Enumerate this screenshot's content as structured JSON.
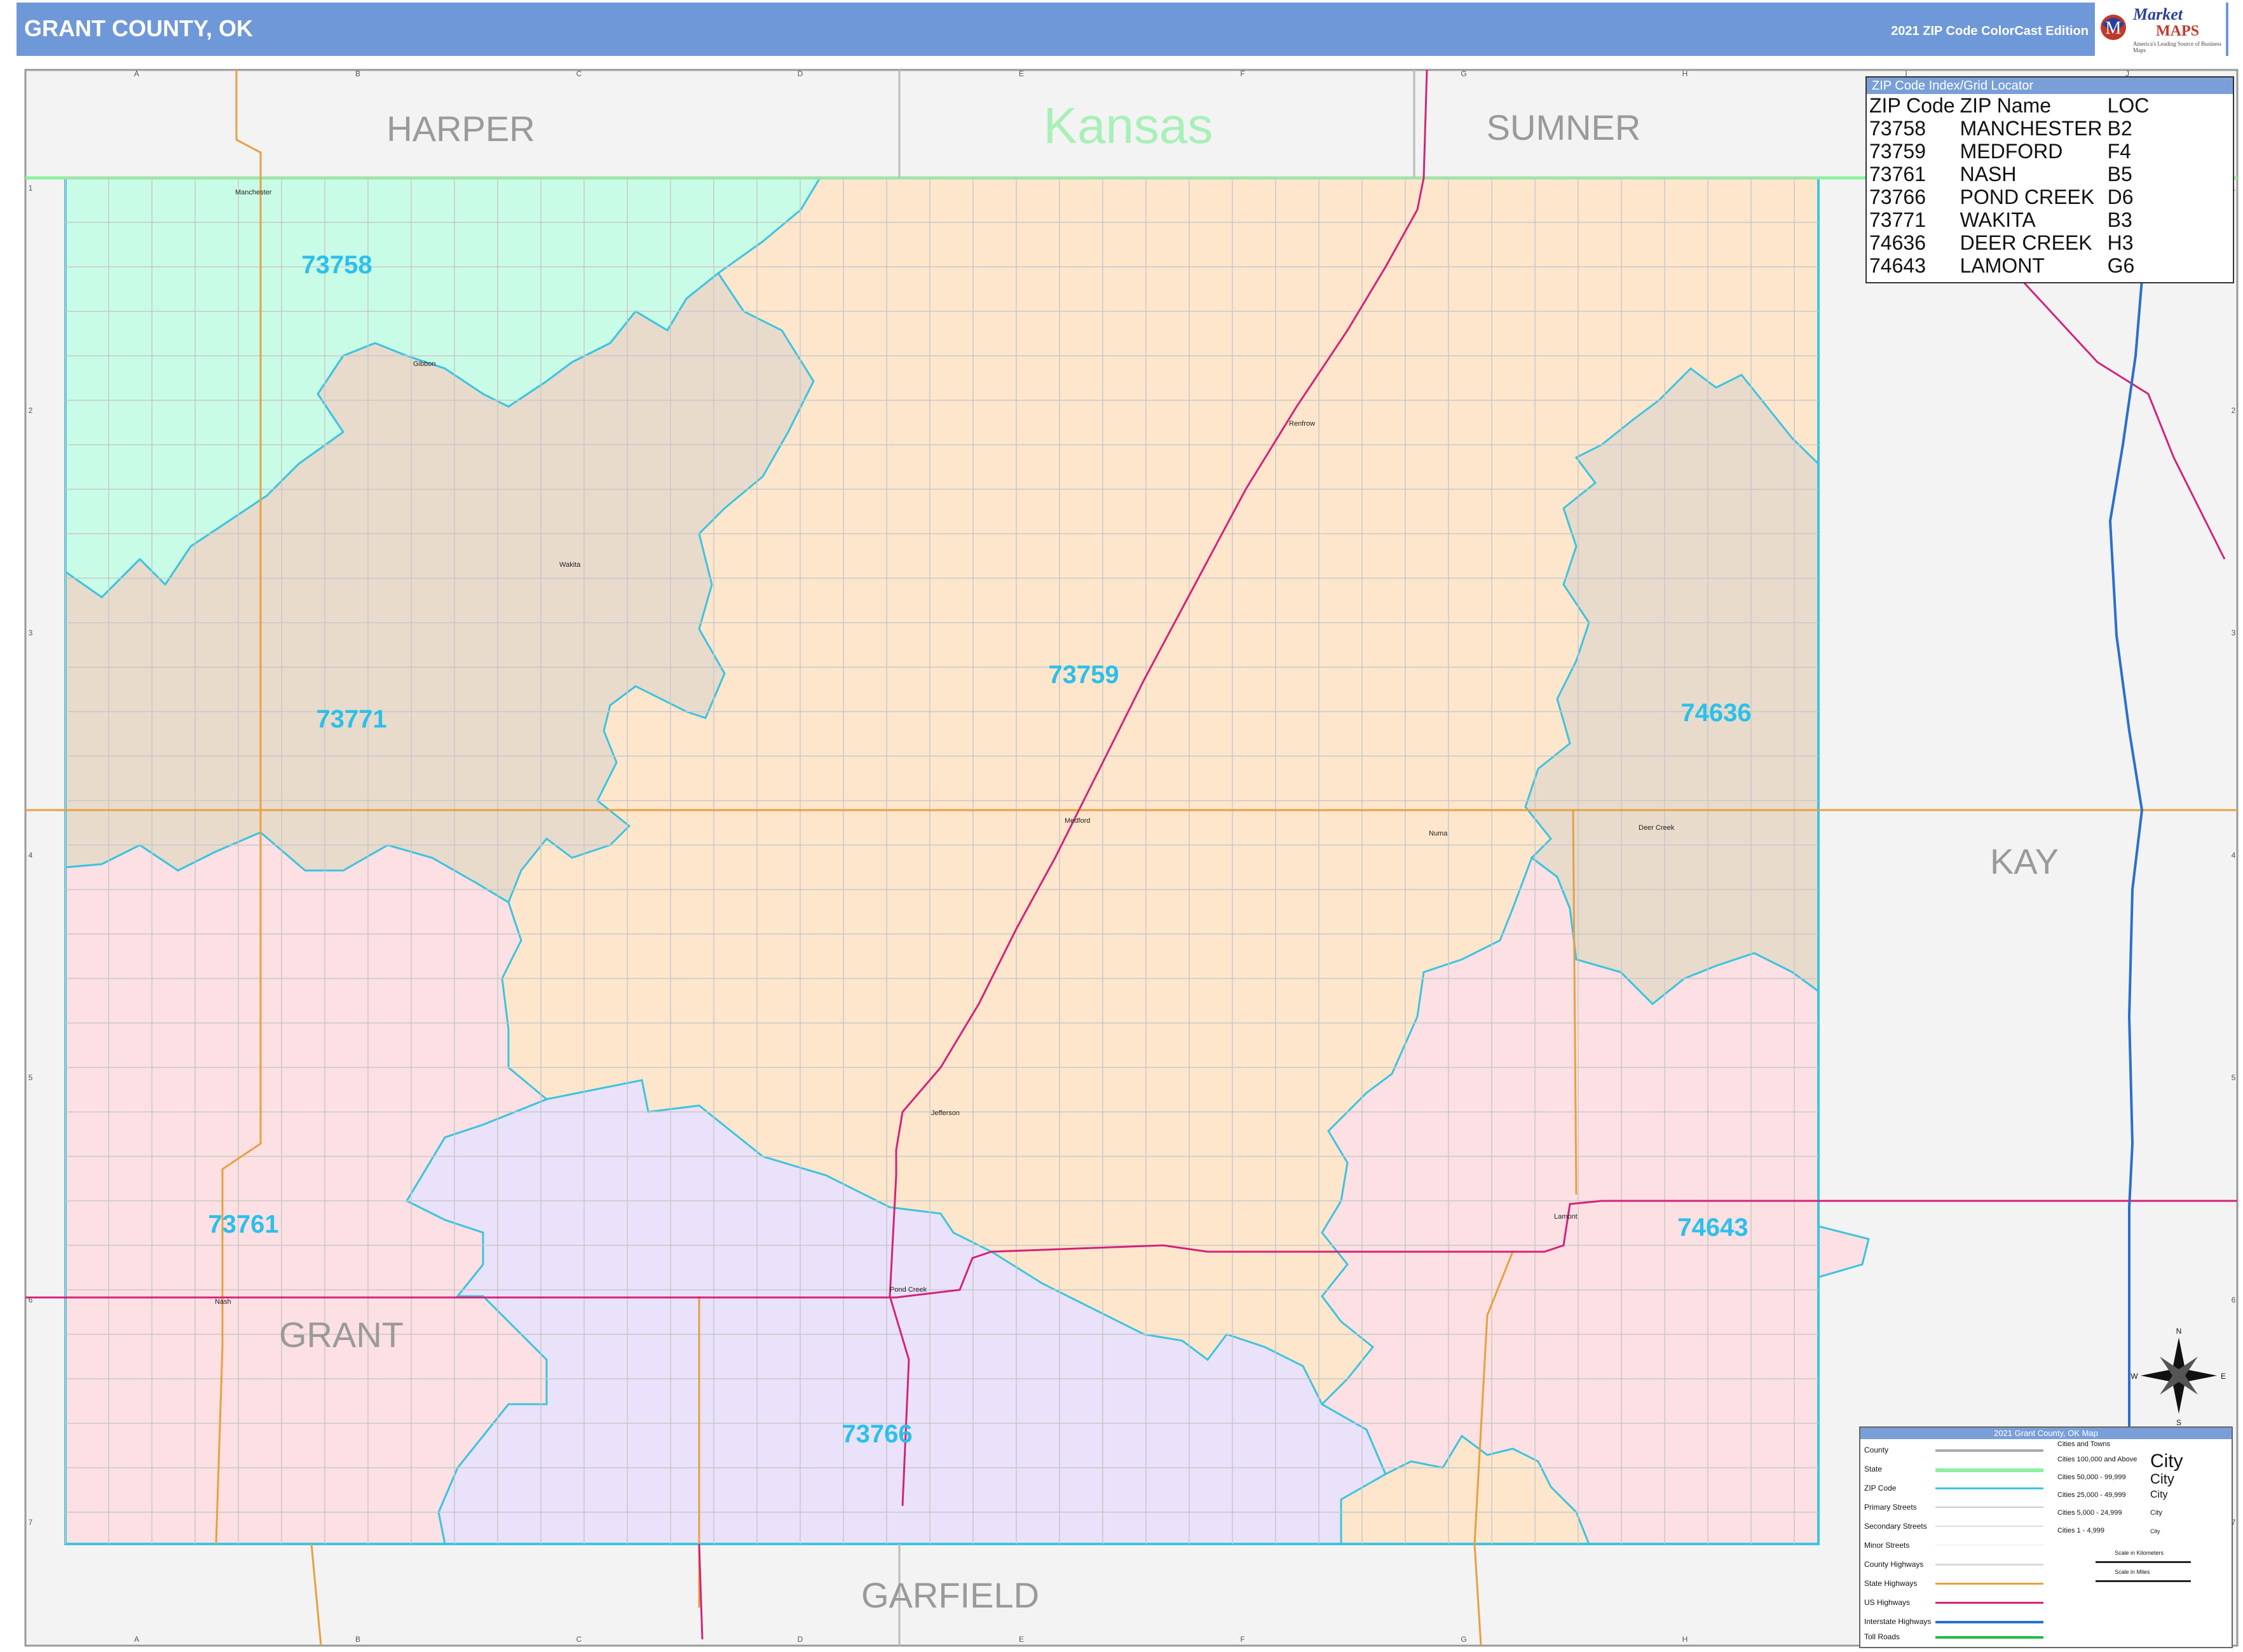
{
  "header": {
    "title": "GRANT COUNTY, OK",
    "edition": "2021 ZIP Code ColorCast Edition"
  },
  "logo": {
    "brand": "Market",
    "brand2": "MAPS",
    "tagline": "America's Leading Source of Business Maps"
  },
  "colors": {
    "header_bg": "#6f98d8",
    "zip_73758": "#c9fce6",
    "zip_73759": "#fde6cc",
    "zip_73761": "#fde0e3",
    "zip_73766": "#eae2fb",
    "zip_73771": "#e8dbcc",
    "zip_74636": "#e8dbcc",
    "zip_74643": "#fde0e3",
    "zip_border": "#3cc4e0",
    "us_highway": "#d4237a",
    "state_highway": "#e8a040",
    "interstate": "#2a6fd0",
    "state_line": "#8ef0a0",
    "outside": "#f2f2f2"
  },
  "map": {
    "state_label": "Kansas",
    "neighbor_counties": [
      "HARPER",
      "SUMNER",
      "KAY",
      "GARFIELD"
    ],
    "county_label": "GRANT",
    "col_letters": [
      "A",
      "B",
      "C",
      "D",
      "E",
      "F",
      "G",
      "H",
      "I",
      "J"
    ],
    "row_numbers": [
      "1",
      "2",
      "3",
      "4",
      "5",
      "6",
      "7"
    ],
    "zip_labels": [
      {
        "zip": "73758"
      },
      {
        "zip": "73771"
      },
      {
        "zip": "73759"
      },
      {
        "zip": "74636"
      },
      {
        "zip": "73761"
      },
      {
        "zip": "74643"
      },
      {
        "zip": "73766"
      }
    ],
    "towns": [
      "Manchester",
      "Gibbon",
      "Wakita",
      "Renfrow",
      "Medford",
      "Numa",
      "Deer Creek",
      "Jefferson",
      "Lamont",
      "Pond Creek",
      "Nash"
    ]
  },
  "zip_index": {
    "title": "ZIP Code Index/Grid Locator",
    "columns": [
      "ZIP Code",
      "ZIP Name",
      "LOC"
    ],
    "rows": [
      [
        "73758",
        "MANCHESTER",
        "B2"
      ],
      [
        "73759",
        "MEDFORD",
        "F4"
      ],
      [
        "73761",
        "NASH",
        "B5"
      ],
      [
        "73766",
        "POND CREEK",
        "D6"
      ],
      [
        "73771",
        "WAKITA",
        "B3"
      ],
      [
        "74636",
        "DEER CREEK",
        "H3"
      ],
      [
        "74643",
        "LAMONT",
        "G6"
      ]
    ]
  },
  "legend": {
    "title": "2021 Grant County, OK Map",
    "items": [
      "County",
      "State",
      "ZIP Code",
      "Primary Streets",
      "Secondary Streets",
      "Minor Streets",
      "County Highways",
      "State Highways",
      "US Highways",
      "Interstate Highways",
      "Toll Roads"
    ],
    "cities_header": "Cities and Towns",
    "city_tiers": [
      {
        "range": "Cities 100,000 and Above",
        "sample": "City"
      },
      {
        "range": "Cities 50,000 - 99,999",
        "sample": "City"
      },
      {
        "range": "Cities 25,000 - 49,999",
        "sample": "City"
      },
      {
        "range": "Cities 5,000 - 24,999",
        "sample": "City"
      },
      {
        "range": "Cities 1 - 4,999",
        "sample": "City"
      }
    ],
    "scale_km": "Scale in Kilometers",
    "scale_mi": "Scale in Miles"
  },
  "compass": {
    "n": "N",
    "s": "S",
    "e": "E",
    "w": "W"
  }
}
